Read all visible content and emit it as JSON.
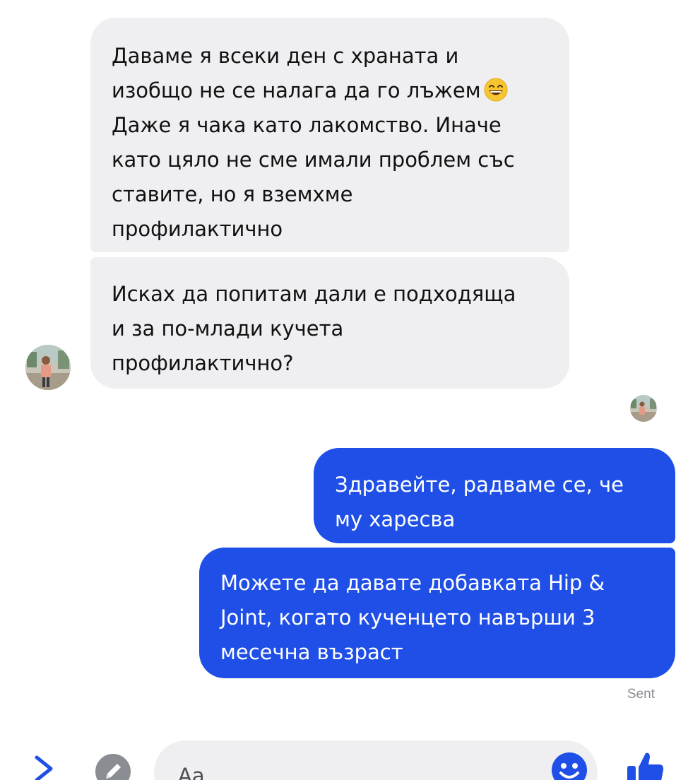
{
  "messages": {
    "incoming_1": {
      "lines": [
        "Даваме я всеки ден с храната и",
        "изобщо не се налага да го лъжем",
        "Даже я чака като лакомство. Иначе",
        "като цяло не сме имали проблем със",
        "ставите, но я вземхме",
        "профилактично"
      ],
      "emoji": "grinning-face-smiling-eyes"
    },
    "incoming_2": {
      "lines": [
        "Исках да попитам дали е подходяща",
        "и за по-млади кучета",
        "профилактично?"
      ]
    },
    "outgoing_1": {
      "lines": [
        "Здравейте, радваме се, че",
        "му харесва"
      ]
    },
    "outgoing_2": {
      "lines": [
        "Можете да давате добавката Hip &",
        "Joint, когато кученцето навърши 3",
        "месечна възраст"
      ]
    },
    "status": "Sent"
  },
  "composer": {
    "placeholder": "Aa"
  },
  "icons": {
    "left_chevron": "chevron-right-icon",
    "attachment": "pencil-icon",
    "emoji": "smile-icon",
    "like": "thumbs-up-icon"
  },
  "colors": {
    "incoming_bubble": "#efeff2",
    "outgoing_bubble": "#1f4fe6",
    "accent": "#1f4fe6",
    "status_text": "#8a8d91"
  }
}
